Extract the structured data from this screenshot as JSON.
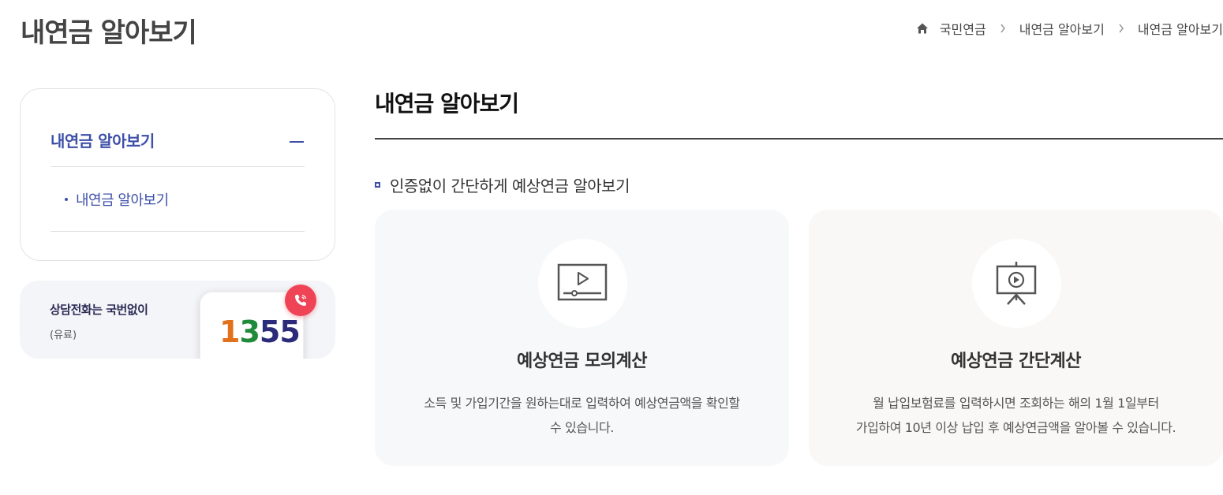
{
  "page": {
    "title": "내연금 알아보기"
  },
  "breadcrumb": {
    "items": [
      "국민연금",
      "내연금 알아보기",
      "내연금 알아보기"
    ]
  },
  "side_menu": {
    "heading": "내연금 알아보기",
    "sub_items": [
      "내연금 알아보기"
    ]
  },
  "call_banner": {
    "title": "상담전화는 국번없이",
    "note": "(유료)",
    "number_parts": [
      "1",
      "3",
      "55"
    ]
  },
  "main": {
    "section_title": "내연금 알아보기",
    "sub_heading": "인증없이 간단하게 예상연금 알아보기",
    "cards": [
      {
        "icon": "video-play-icon",
        "title": "예상연금 모의계산",
        "desc_line1": "소득 및 가입기간을 원하는대로 입력하여 예상연금액을 확인할",
        "desc_line2": "수 있습니다."
      },
      {
        "icon": "presentation-board-icon",
        "title": "예상연금 간단계산",
        "desc_line1": "월 납입보험료를 입력하시면 조회하는 해의 1월 1일부터",
        "desc_line2": "가입하여 10년 이상 납입 후 예상연금액을 알아볼 수 있습니다."
      }
    ]
  },
  "colors": {
    "accent": "#3d50a8",
    "call_badge": "#ef4456"
  }
}
